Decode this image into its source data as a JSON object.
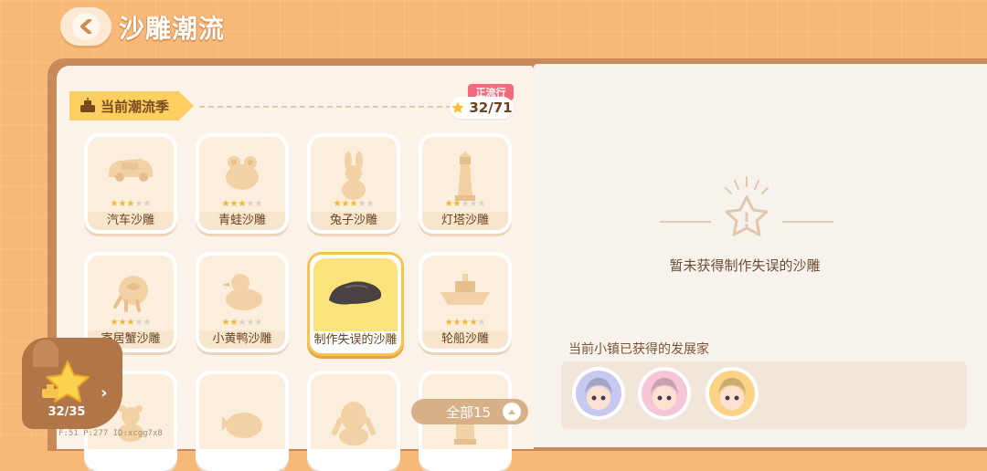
{
  "header": {
    "title": "沙雕潮流"
  },
  "season": {
    "label": "当前潮流季",
    "tag": "正流行",
    "progress": "32/71"
  },
  "cards": [
    {
      "name": "汽车沙雕",
      "stars": 3,
      "max": 5,
      "icon": "car-sculpture-icon"
    },
    {
      "name": "青蛙沙雕",
      "stars": 3,
      "max": 5,
      "icon": "frog-sculpture-icon"
    },
    {
      "name": "兔子沙雕",
      "stars": 3,
      "max": 5,
      "icon": "rabbit-sculpture-icon"
    },
    {
      "name": "灯塔沙雕",
      "stars": 2,
      "max": 5,
      "icon": "lighthouse-sculpture-icon"
    },
    {
      "name": "寄居蟹沙雕",
      "stars": 3,
      "max": 5,
      "icon": "hermit-crab-sculpture-icon"
    },
    {
      "name": "小黄鸭沙雕",
      "stars": 2,
      "max": 5,
      "icon": "duck-sculpture-icon"
    },
    {
      "name": "制作失误的沙雕",
      "stars": 0,
      "max": 0,
      "icon": "failed-sculpture-icon",
      "selected": true
    },
    {
      "name": "轮船沙雕",
      "stars": 4,
      "max": 5,
      "icon": "ship-sculpture-icon"
    },
    {
      "name": "",
      "stars": 0,
      "max": 0,
      "icon": "bear-sculpture-icon"
    },
    {
      "name": "",
      "stars": 0,
      "max": 0,
      "icon": "whale-sculpture-icon"
    },
    {
      "name": "",
      "stars": 0,
      "max": 0,
      "icon": "monster-sculpture-icon"
    },
    {
      "name": "",
      "stars": 0,
      "max": 0,
      "icon": "castle-sculpture-icon"
    }
  ],
  "detail": {
    "empty_text": "暂未获得制作失误的沙雕",
    "developers_title": "当前小镇已获得的发展家",
    "developers": [
      {
        "icon": "avatar-white-hair",
        "color": "#c8c9f0"
      },
      {
        "icon": "avatar-pink-hair",
        "color": "#f5c6d6"
      },
      {
        "icon": "avatar-orange-hat",
        "color": "#fbd387"
      }
    ]
  },
  "widget": {
    "count": "32/35"
  },
  "filter": {
    "label": "全部15"
  },
  "debug": "F:51   P:277   ID:xcgg7x8",
  "colors": {
    "accent": "#f6b977",
    "gold": "#f6b52c",
    "tag": "#f16b7d"
  }
}
